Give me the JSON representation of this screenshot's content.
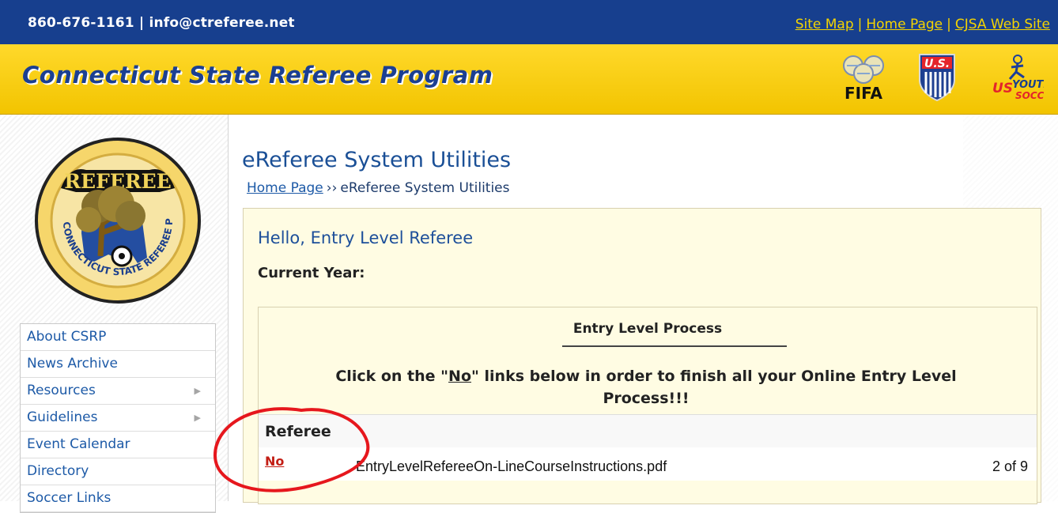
{
  "header": {
    "contact": "860-676-1161 | info@ctreferee.net",
    "links": [
      "Site Map",
      "Home Page",
      "CJSA Web Site"
    ],
    "site_title": "Connecticut State Referee Program",
    "logos": [
      "FIFA",
      "US Soccer",
      "US Youth Soccer"
    ]
  },
  "sidebar": {
    "seal_text": [
      "REFEREE",
      "CONNECTICUT STATE REFEREE PROGRAM"
    ],
    "items": [
      "About CSRP",
      "News Archive",
      "Resources",
      "Guidelines",
      "Event Calendar",
      "Directory",
      "Soccer Links"
    ]
  },
  "main": {
    "title": "eReferee System Utilities",
    "breadcrumb": [
      "Home Page",
      "eReferee System Utilities"
    ],
    "greeting": "Hello, Entry Level Referee",
    "current_year": "Current Year:",
    "process_title": "Entry Level Process",
    "instruction_prefix": "Click on the \"",
    "instruction_link": "No",
    "instruction_suffix": "\" links below in order to finish all your Online Entry Level Process!!!",
    "referee_label": "Referee",
    "no_link": "No"
  },
  "overlay": {
    "file_name": "EntryLevelRefereeOn-LineCourseInstructions.pdf",
    "page_count": "2 of 9"
  },
  "colors": {
    "header_blue": "#173f8e",
    "banner_yellow": "#f2c400",
    "title_blue": "#1a4f96",
    "panel_cream": "#fffce3",
    "annotation_red": "#e6171d"
  },
  "icons": {
    "menu_arrow": "chevron-right-icon",
    "annotation": "red-circle-annotation"
  }
}
